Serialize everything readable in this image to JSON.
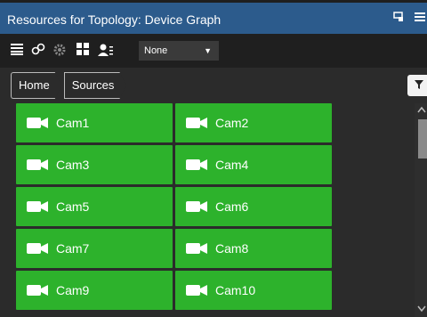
{
  "window": {
    "title": "Resources for Topology: Device Graph"
  },
  "icons": {
    "window_button": "window-icon",
    "menu_button": "hamburger-menu-icon"
  },
  "toolbar": {
    "select_value": "None"
  },
  "breadcrumb": [
    "Home",
    "Sources"
  ],
  "tiles": [
    "Cam1",
    "Cam2",
    "Cam3",
    "Cam4",
    "Cam5",
    "Cam6",
    "Cam7",
    "Cam8",
    "Cam9",
    "Cam10"
  ],
  "colors": {
    "titlebar": "#2c5b8c",
    "toolbar": "#1f1f1f",
    "tile_green": "#2db22c",
    "background": "#2b2b2b"
  }
}
